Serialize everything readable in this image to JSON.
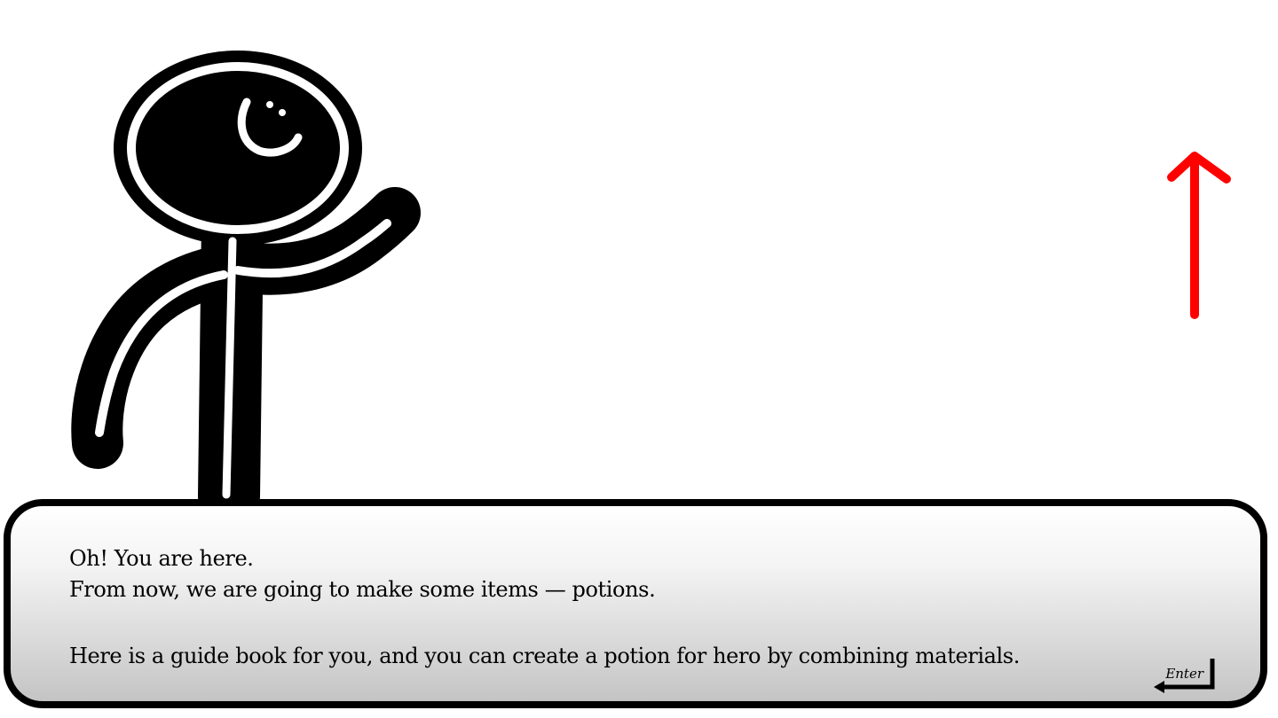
{
  "scene": {
    "character": "stick-figure-guide",
    "pointer_icon": "up-arrow-icon",
    "pointer_color": "#ff0000"
  },
  "dialog": {
    "lines": [
      "Oh! You are here.",
      "From now, we are going to make some items — potions.",
      "Here is a guide book for you, and you can create a potion for hero by combining materials."
    ],
    "continue_label": "Enter",
    "continue_icon": "enter-key-icon"
  }
}
